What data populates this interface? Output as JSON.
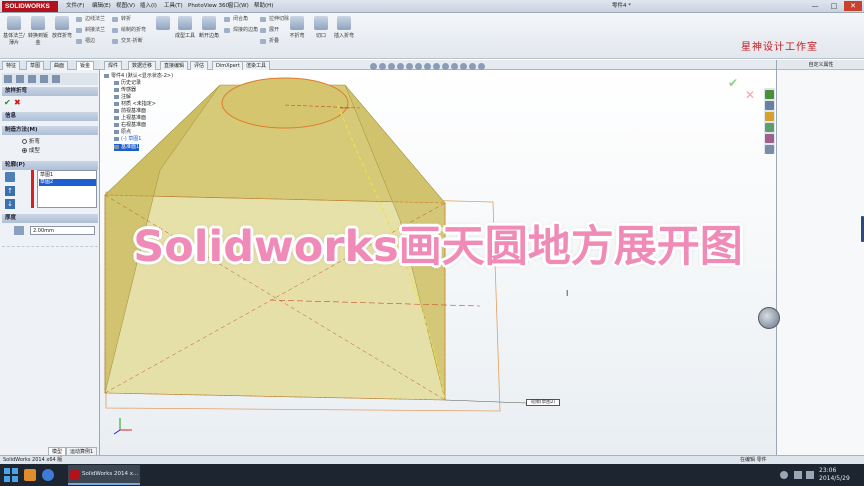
{
  "app": {
    "logo_text": "SOLIDWORKS",
    "doc_title": "零件4 *",
    "menus": [
      "文件(F)",
      "编辑(E)",
      "视图(V)",
      "插入(I)",
      "工具(T)",
      "PhotoView 360",
      "窗口(W)",
      "帮助(H)"
    ],
    "window_controls": [
      "—",
      "□",
      "✕"
    ]
  },
  "ribbon": {
    "large_buttons": [
      "基体法兰/薄片",
      "转换到钣金",
      "放样折弯",
      "边线法兰",
      "斜接法兰",
      "褶边",
      "绘制的折弯",
      "交叉-折断",
      "成型工具",
      "断开边角",
      "闭合角",
      "焊接的边角",
      "拉伸切除",
      "展开",
      "切口",
      "插入折弯"
    ],
    "small_items": [
      "转折",
      "展开",
      "折叠",
      "不折弯",
      "折叠"
    ],
    "studio_label": "星神设计工作室"
  },
  "command_tabs": [
    "特征",
    "草图",
    "曲面",
    "钣金",
    "焊件",
    "数据迁移",
    "直接编辑",
    "评估",
    "DimXpert",
    "渲染工具"
  ],
  "property_manager": {
    "title": "放样折弯",
    "ok": "✔",
    "cancel": "✖",
    "info_header": "信息",
    "method_header": "制造方法(M)",
    "method_options": [
      "折弯",
      "成型"
    ],
    "profile_header": "轮廓(P)",
    "profiles": [
      "草图1",
      "草图2"
    ],
    "thickness_header": "厚度",
    "thickness_value": "2.00mm"
  },
  "tree": {
    "root": "零件4  (默认<显示状态-2>)",
    "items": [
      "历史记录",
      "传感器",
      "注解",
      "材质 <未指定>",
      "前视基准面",
      "上视基准面",
      "右视基准面",
      "原点",
      "(-) 草图1",
      "基准面1"
    ]
  },
  "viewport": {
    "callout": "轮廓(草图2)"
  },
  "right_pane": {
    "title": "自定义属性"
  },
  "overlay": {
    "title": "Solidworks画天圆地方展开图"
  },
  "status": {
    "left": "SolidWorks 2014 x64 版",
    "right": "在编辑 零件"
  },
  "bottom_tabs": [
    "模型",
    "运动算例1"
  ],
  "taskbar": {
    "app_label": "SolidWorks 2014 x...",
    "time": "23:06",
    "date": "2014/5/29"
  },
  "colors": {
    "accent": "#f08ab6",
    "solid_fill": "#d8cf7a",
    "edge_highlight": "#e07a2a",
    "studio_red": "#c8181c"
  }
}
